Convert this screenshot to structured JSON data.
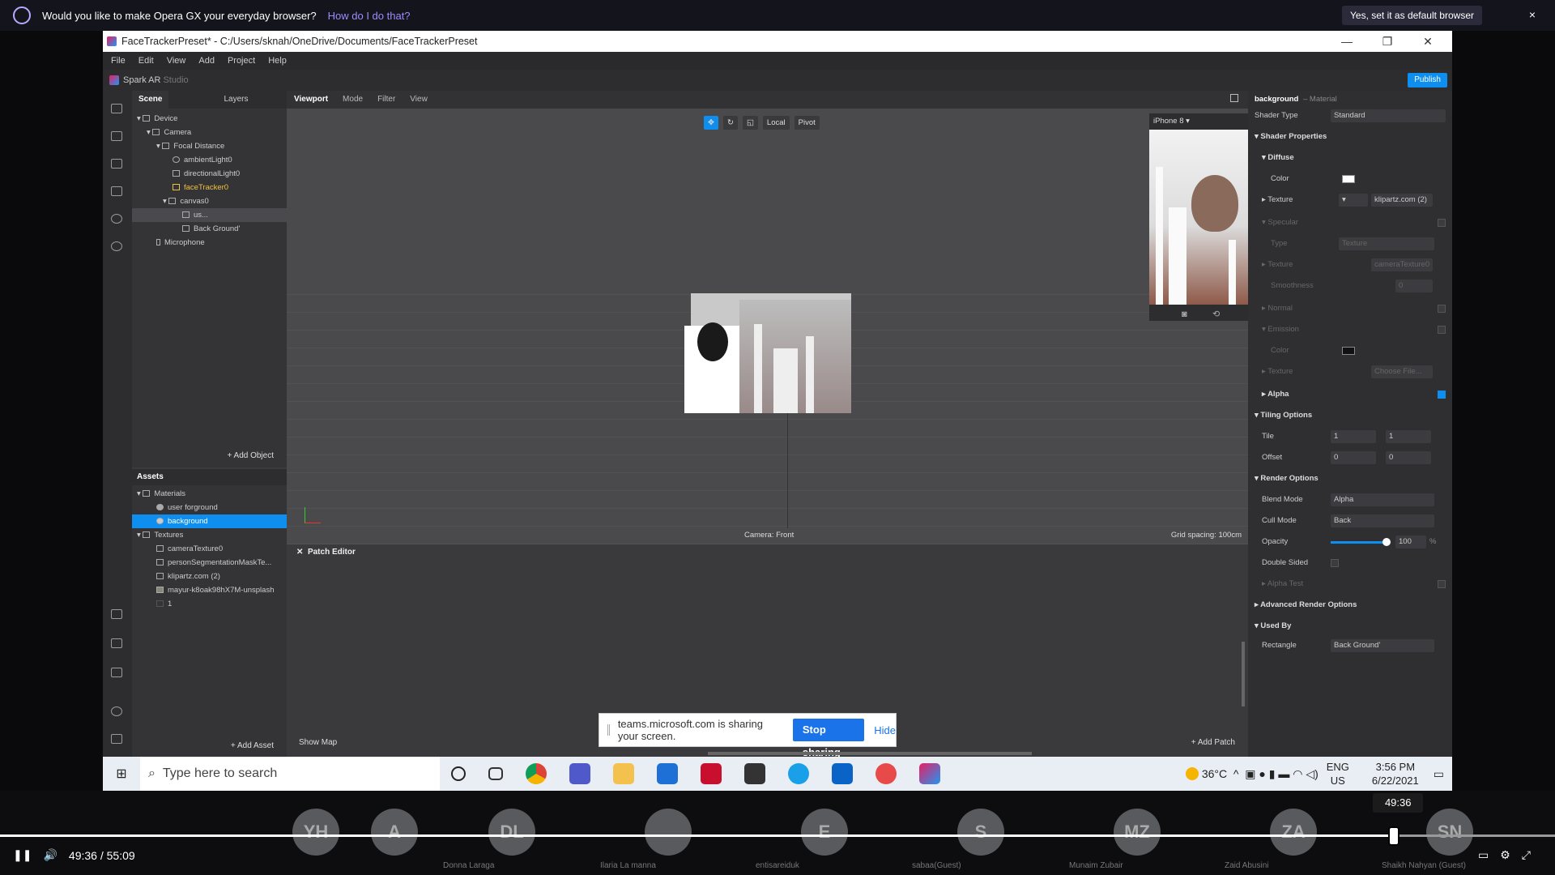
{
  "opera": {
    "prompt": "Would you like to make Opera GX your everyday browser?",
    "link": "How do I do that?",
    "button": "Yes, set it as default browser",
    "close": "×"
  },
  "window": {
    "title": "FaceTrackerPreset* - C:/Users/sknah/OneDrive/Documents/FaceTrackerPreset",
    "minimize": "—",
    "maximize": "❐",
    "close": "✕"
  },
  "menu": [
    "File",
    "Edit",
    "View",
    "Add",
    "Project",
    "Help"
  ],
  "brand": {
    "name": "Spark AR",
    "studio": "Studio",
    "publish": "Publish"
  },
  "scene": {
    "tabs": [
      "Scene",
      "Layers"
    ],
    "items": [
      "Device",
      "Camera",
      "Focal Distance",
      "ambientLight0",
      "directionalLight0",
      "faceTracker0",
      "canvas0",
      "us...",
      "Back Ground'",
      "Microphone"
    ],
    "add_object": "+ Add Object"
  },
  "assets": {
    "title": "Assets",
    "items": [
      "Materials",
      "user forground",
      "background",
      "Textures",
      "cameraTexture0",
      "personSegmentationMaskTe...",
      "klipartz.com (2)",
      "mayur-k8oak98hX7M-unsplash",
      "1"
    ],
    "add_asset": "+ Add Asset"
  },
  "viewport": {
    "tabs": [
      "Viewport",
      "Mode",
      "Filter",
      "View"
    ],
    "tools": [
      "✥",
      "↻",
      "◱",
      "Local",
      "Pivot"
    ],
    "camera_label": "Camera: Front",
    "grid_label": "Grid spacing: 100cm",
    "device": "iPhone 8"
  },
  "patch": {
    "title": "Patch Editor",
    "close": "✕",
    "show_map": "Show Map",
    "add_patch": "+ Add Patch"
  },
  "share_bar": {
    "text": "teams.microsoft.com is sharing your screen.",
    "stop": "Stop sharing",
    "hide": "Hide"
  },
  "inspector": {
    "title": "background",
    "kind": "– Material",
    "shader_type_label": "Shader Type",
    "shader_type": "Standard",
    "shader_props": "Shader Properties",
    "diffuse": "Diffuse",
    "color": "Color",
    "texture": "Texture",
    "texture_val": "klipartz.com (2)",
    "specular": "Specular",
    "type": "Type",
    "type_val": "Texture",
    "spec_texture_val": "cameraTexture0",
    "smoothness": "Smoothness",
    "smoothness_val": "0",
    "normal": "Normal",
    "emission": "Emission",
    "em_color": "Color",
    "em_texture": "Texture",
    "choose_file": "Choose File...",
    "alpha": "Alpha",
    "tiling": "Tiling Options",
    "tile": "Tile",
    "tile_x": "1",
    "tile_y": "1",
    "offset": "Offset",
    "off_x": "0",
    "off_y": "0",
    "render": "Render Options",
    "blend_mode": "Blend Mode",
    "blend_val": "Alpha",
    "cull_mode": "Cull Mode",
    "cull_val": "Back",
    "opacity": "Opacity",
    "opacity_val": "100",
    "opacity_pct": "%",
    "double_sided": "Double Sided",
    "alpha_test": "Alpha Test",
    "advanced": "Advanced Render Options",
    "used_by": "Used By",
    "rectangle": "Rectangle",
    "rectangle_val": "Back Ground'"
  },
  "taskbar": {
    "search_placeholder": "Type here to search",
    "temp": "36°C",
    "lang1": "ENG",
    "lang2": "US",
    "time": "3:56 PM",
    "date": "6/22/2021"
  },
  "video": {
    "current": "49:36",
    "duration": "55:09",
    "separator": "/",
    "tooltip": "49:36",
    "progress": 0.897,
    "participants": [
      {
        "initials": "YH",
        "name": ""
      },
      {
        "initials": "A",
        "name": ""
      },
      {
        "initials": "DL",
        "name": "Donna Laraga"
      },
      {
        "initials": "",
        "name": "Ilaria  La manna"
      },
      {
        "initials": "E",
        "name": "entisareiduk"
      },
      {
        "initials": "S",
        "name": "sabaa(Guest)"
      },
      {
        "initials": "MZ",
        "name": "Munaim Zubair"
      },
      {
        "initials": "ZA",
        "name": "Zaid Abusini"
      },
      {
        "initials": "SN",
        "name": "Shaikh Nahyan (Guest)"
      }
    ]
  },
  "colors": {
    "accent": "#0e8ff0",
    "teams_blue": "#1a73e8"
  }
}
